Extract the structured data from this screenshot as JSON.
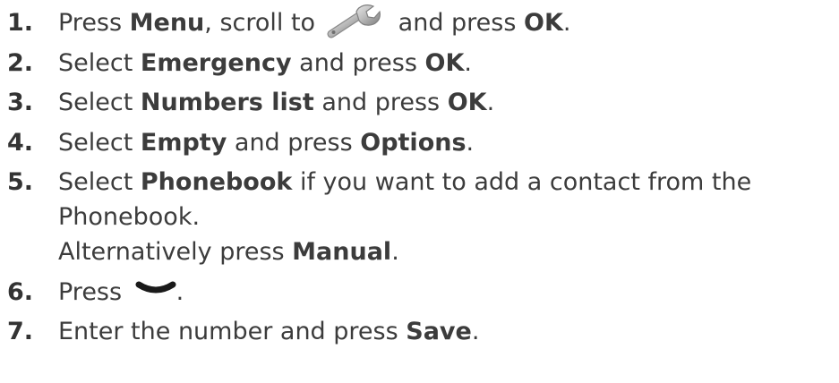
{
  "steps": [
    {
      "number": "1.",
      "t1": "Press ",
      "k1": "Menu",
      "t2": ", scroll to",
      "t3": " and press ",
      "k2": "OK",
      "t4": ".",
      "icon": "wrench-icon"
    },
    {
      "number": "2.",
      "t1": "Select ",
      "k1": "Emergency",
      "t2": " and press ",
      "k2": "OK",
      "t3": "."
    },
    {
      "number": "3.",
      "t1": "Select ",
      "k1": "Numbers list",
      "t2": " and press ",
      "k2": "OK",
      "t3": "."
    },
    {
      "number": "4.",
      "t1": "Select ",
      "k1": "Empty",
      "t2": " and press ",
      "k2": "Options",
      "t3": "."
    },
    {
      "number": "5.",
      "t1": "Select ",
      "k1": "Phonebook",
      "t2": " if you want to add a contact from the",
      "line2": "Phonebook.",
      "t3": "Alternatively press ",
      "k2": "Manual",
      "t4": "."
    },
    {
      "number": "6.",
      "t1": "Press ",
      "t2": ".",
      "icon": "chevron-down-icon"
    },
    {
      "number": "7.",
      "t1": "Enter the number and press ",
      "k1": "Save",
      "t2": "."
    }
  ],
  "colors": {
    "text": "#3c3c3c",
    "number": "#333333",
    "background": "#ffffff"
  }
}
